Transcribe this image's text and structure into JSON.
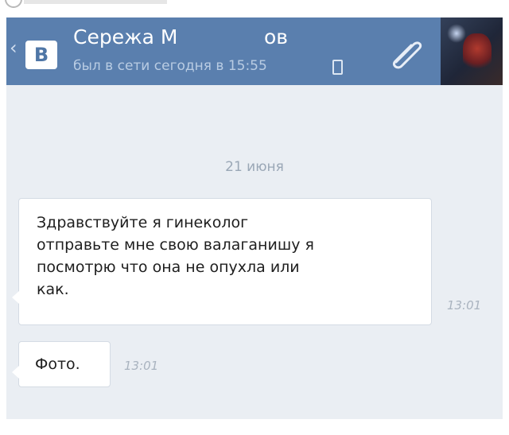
{
  "header": {
    "back_glyph": "‹",
    "logo_letter": "В",
    "name_first": "Сережа М",
    "name_last": "ов",
    "status": "был в сети сегодня в 15:55",
    "icons": [
      "back-chevron-icon",
      "vk-logo",
      "mobile-phone-icon",
      "paperclip-icon",
      "avatar"
    ],
    "colors": {
      "bar": "#5a7fae",
      "status_text": "#b9cce3"
    }
  },
  "chat": {
    "date_separator": "21 июня",
    "messages": [
      {
        "lines": [
          "Здравствуйте я гинеколог",
          "отправьте мне свою валаганишу я",
          "посмотрю что она не опухла или",
          "как."
        ],
        "time": "13:01"
      },
      {
        "text": "Фото.",
        "time": "13:01"
      }
    ],
    "colors": {
      "background": "#eaeef3",
      "bubble": "#ffffff"
    }
  }
}
